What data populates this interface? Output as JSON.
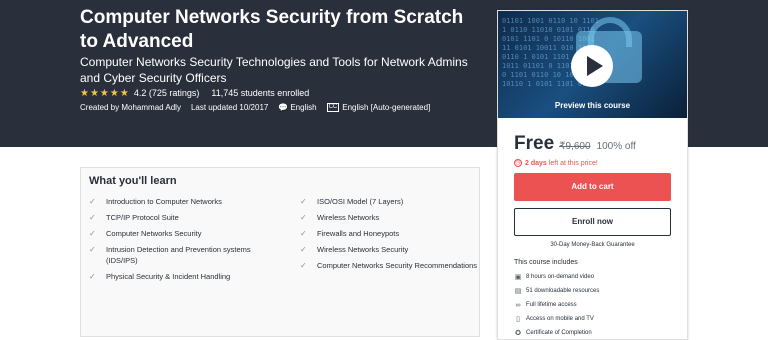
{
  "course": {
    "title": "Computer Networks Security from Scratch to Advanced",
    "subtitle": "Computer Networks Security Technologies and Tools for Network Admins and Cyber Security Officers",
    "stars": "★★★★★",
    "rating": "4.2 (725 ratings)",
    "enrolled": "11,745 students enrolled",
    "created_by": "Created by Mohammad Adly",
    "last_updated": "Last updated 10/2017",
    "language": "English",
    "captions_badge": "CC",
    "captions": "English [Auto-generated]"
  },
  "sidebar": {
    "preview_label": "Preview this course",
    "price": "Free",
    "original_price": "₹9,600",
    "discount": "100% off",
    "timer_bold": "2 days",
    "timer_rest": "left at this price!",
    "add_to_cart": "Add to cart",
    "enroll_now": "Enroll now",
    "guarantee": "30-Day Money-Back Guarantee",
    "includes_title": "This course includes",
    "includes": [
      {
        "icon": "video-icon",
        "label": "8 hours on-demand video"
      },
      {
        "icon": "file-icon",
        "label": "51 downloadable resources"
      },
      {
        "icon": "infinity-icon",
        "label": "Full lifetime access"
      },
      {
        "icon": "mobile-icon",
        "label": "Access on mobile and TV"
      },
      {
        "icon": "trophy-icon",
        "label": "Certificate of Completion"
      }
    ]
  },
  "learn": {
    "title": "What you'll learn",
    "left": [
      "Introduction to Computer Networks",
      "TCP/IP Protocol Suite",
      "Computer Networks Security",
      "Intrusion Detection and Prevention systems (IDS/IPS)",
      "Physical Security & Incident Handling"
    ],
    "right": [
      "ISO/OSI Model (7 Layers)",
      "Wireless Networks",
      "Firewalls and Honeypots",
      "Wireless Networks Security",
      "Computer Networks Security Recommendations"
    ]
  },
  "colors": {
    "hero_bg": "#29303b",
    "accent_red": "#ec5252",
    "star": "#f4c150"
  }
}
